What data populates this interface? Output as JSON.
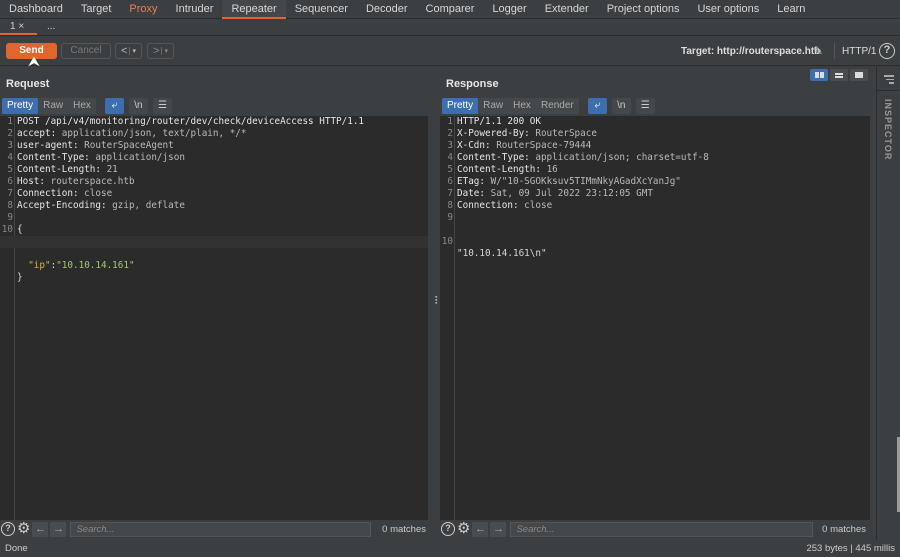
{
  "topnav": {
    "tabs": [
      {
        "label": "Dashboard"
      },
      {
        "label": "Target"
      },
      {
        "label": "Proxy"
      },
      {
        "label": "Intruder"
      },
      {
        "label": "Repeater"
      },
      {
        "label": "Sequencer"
      },
      {
        "label": "Decoder"
      },
      {
        "label": "Comparer"
      },
      {
        "label": "Logger"
      },
      {
        "label": "Extender"
      },
      {
        "label": "Project options"
      },
      {
        "label": "User options"
      },
      {
        "label": "Learn"
      }
    ],
    "active": "Repeater",
    "highlight": "Proxy"
  },
  "subtabs": {
    "tab1": "1 ×",
    "more": "..."
  },
  "toolbar": {
    "send_label": "Send",
    "cancel_label": "Cancel",
    "prev_label": "<",
    "next_label": ">",
    "dropdown_glyph": "▾",
    "target_label": "Target: http://routerspace.htb",
    "edit_icon": "✎",
    "http_version": "HTTP/1",
    "help_glyph": "?"
  },
  "request": {
    "title": "Request",
    "view_tabs": [
      "Pretty",
      "Raw",
      "Hex"
    ],
    "active_view": "Pretty",
    "wrap_icon": "≡",
    "newline_label": "\\n",
    "menu_icon": "☰",
    "lines": [
      {
        "n": "1",
        "key": "POST /api/v4/monitoring/router/dev/check/deviceAccess HTTP/1.1",
        "val": ""
      },
      {
        "n": "2",
        "key": "accept:",
        "val": " application/json, text/plain, */*"
      },
      {
        "n": "3",
        "key": "user-agent:",
        "val": " RouterSpaceAgent"
      },
      {
        "n": "4",
        "key": "Content-Type:",
        "val": " application/json"
      },
      {
        "n": "5",
        "key": "Content-Length:",
        "val": " 21"
      },
      {
        "n": "6",
        "key": "Host:",
        "val": " routerspace.htb"
      },
      {
        "n": "7",
        "key": "Connection:",
        "val": " close"
      },
      {
        "n": "8",
        "key": "Accept-Encoding:",
        "val": " gzip, deflate"
      },
      {
        "n": "9",
        "key": "",
        "val": ""
      },
      {
        "n": "10",
        "key": "{",
        "val": ""
      }
    ],
    "json_key": "\"ip\"",
    "json_colon": ":",
    "json_value": "\"10.10.14.161\"",
    "json_close": "}",
    "search_placeholder": "Search...",
    "matches": "0 matches"
  },
  "response": {
    "title": "Response",
    "view_tabs": [
      "Pretty",
      "Raw",
      "Hex",
      "Render"
    ],
    "active_view": "Pretty",
    "newline_label": "\\n",
    "lines": [
      {
        "n": "1",
        "key": "HTTP/1.1 200 OK",
        "val": ""
      },
      {
        "n": "2",
        "key": "X-Powered-By:",
        "val": " RouterSpace"
      },
      {
        "n": "3",
        "key": "X-Cdn:",
        "val": " RouterSpace-79444"
      },
      {
        "n": "4",
        "key": "Content-Type:",
        "val": " application/json; charset=utf-8"
      },
      {
        "n": "5",
        "key": "Content-Length:",
        "val": " 16"
      },
      {
        "n": "6",
        "key": "ETag:",
        "val": " W/\"10-SGOKksuv5TIMmNkyAGadXcYanJg\""
      },
      {
        "n": "7",
        "key": "Date:",
        "val": " Sat, 09 Jul 2022 23:12:05 GMT"
      },
      {
        "n": "8",
        "key": "Connection:",
        "val": " close"
      },
      {
        "n": "9",
        "key": "",
        "val": ""
      }
    ],
    "body_line_n": "10",
    "body": "\"10.10.14.161\\n\"",
    "search_placeholder": "Search...",
    "matches": "0 matches"
  },
  "inspector": {
    "label": "INSPECTOR"
  },
  "statusbar": {
    "left": "Done",
    "right": "253 bytes | 445 millis"
  },
  "colors": {
    "accent": "#e0662e",
    "selected_blue": "#3d6fb0",
    "json_key": "#e0b03c",
    "json_string": "#a8c86a"
  }
}
